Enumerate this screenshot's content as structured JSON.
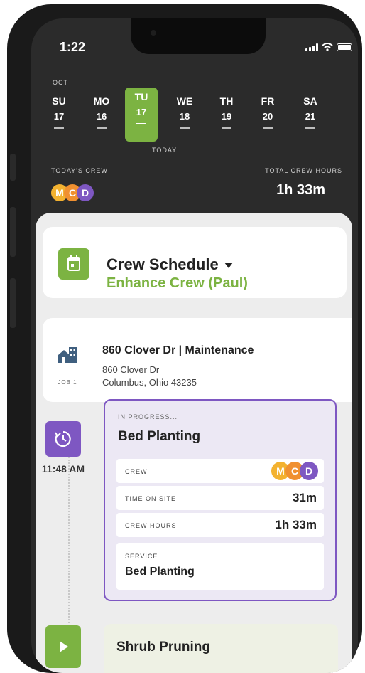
{
  "status_bar": {
    "time": "1:22"
  },
  "calendar": {
    "month": "OCT",
    "days": [
      {
        "name": "SU",
        "date": "17"
      },
      {
        "name": "MO",
        "date": "16"
      },
      {
        "name": "TU",
        "date": "17"
      },
      {
        "name": "WE",
        "date": "18"
      },
      {
        "name": "TH",
        "date": "19"
      },
      {
        "name": "FR",
        "date": "20"
      },
      {
        "name": "SA",
        "date": "21"
      }
    ],
    "selected_index": 2,
    "today_label": "TODAY"
  },
  "summary": {
    "crew_label": "TODAY'S CREW",
    "crew": [
      {
        "initial": "M"
      },
      {
        "initial": "C"
      },
      {
        "initial": "D"
      }
    ],
    "hours_label": "TOTAL CREW HOURS",
    "hours_value": "1h 33m"
  },
  "schedule_header": {
    "title": "Crew Schedule",
    "subtitle": "Enhance Crew (Paul)"
  },
  "job": {
    "title": "860 Clover Dr | Maintenance",
    "address_line1": "860 Clover Dr",
    "address_line2": "Columbus, Ohio  43235",
    "number_label": "JOB 1"
  },
  "active_task": {
    "time": "11:48 AM",
    "status": "IN PROGRESS...",
    "title": "Bed Planting",
    "crew_label": "CREW",
    "time_on_site_label": "TIME ON SITE",
    "time_on_site_value": "31m",
    "crew_hours_label": "CREW HOURS",
    "crew_hours_value": "1h 33m",
    "service_label": "SERVICE",
    "service_value": "Bed Planting"
  },
  "next_task": {
    "title": "Shrub Pruning"
  },
  "colors": {
    "accent_green": "#7cb342",
    "accent_purple": "#7e57c2",
    "crew_m": "#f3b230",
    "crew_c": "#f09030",
    "crew_d": "#7e57c2"
  }
}
